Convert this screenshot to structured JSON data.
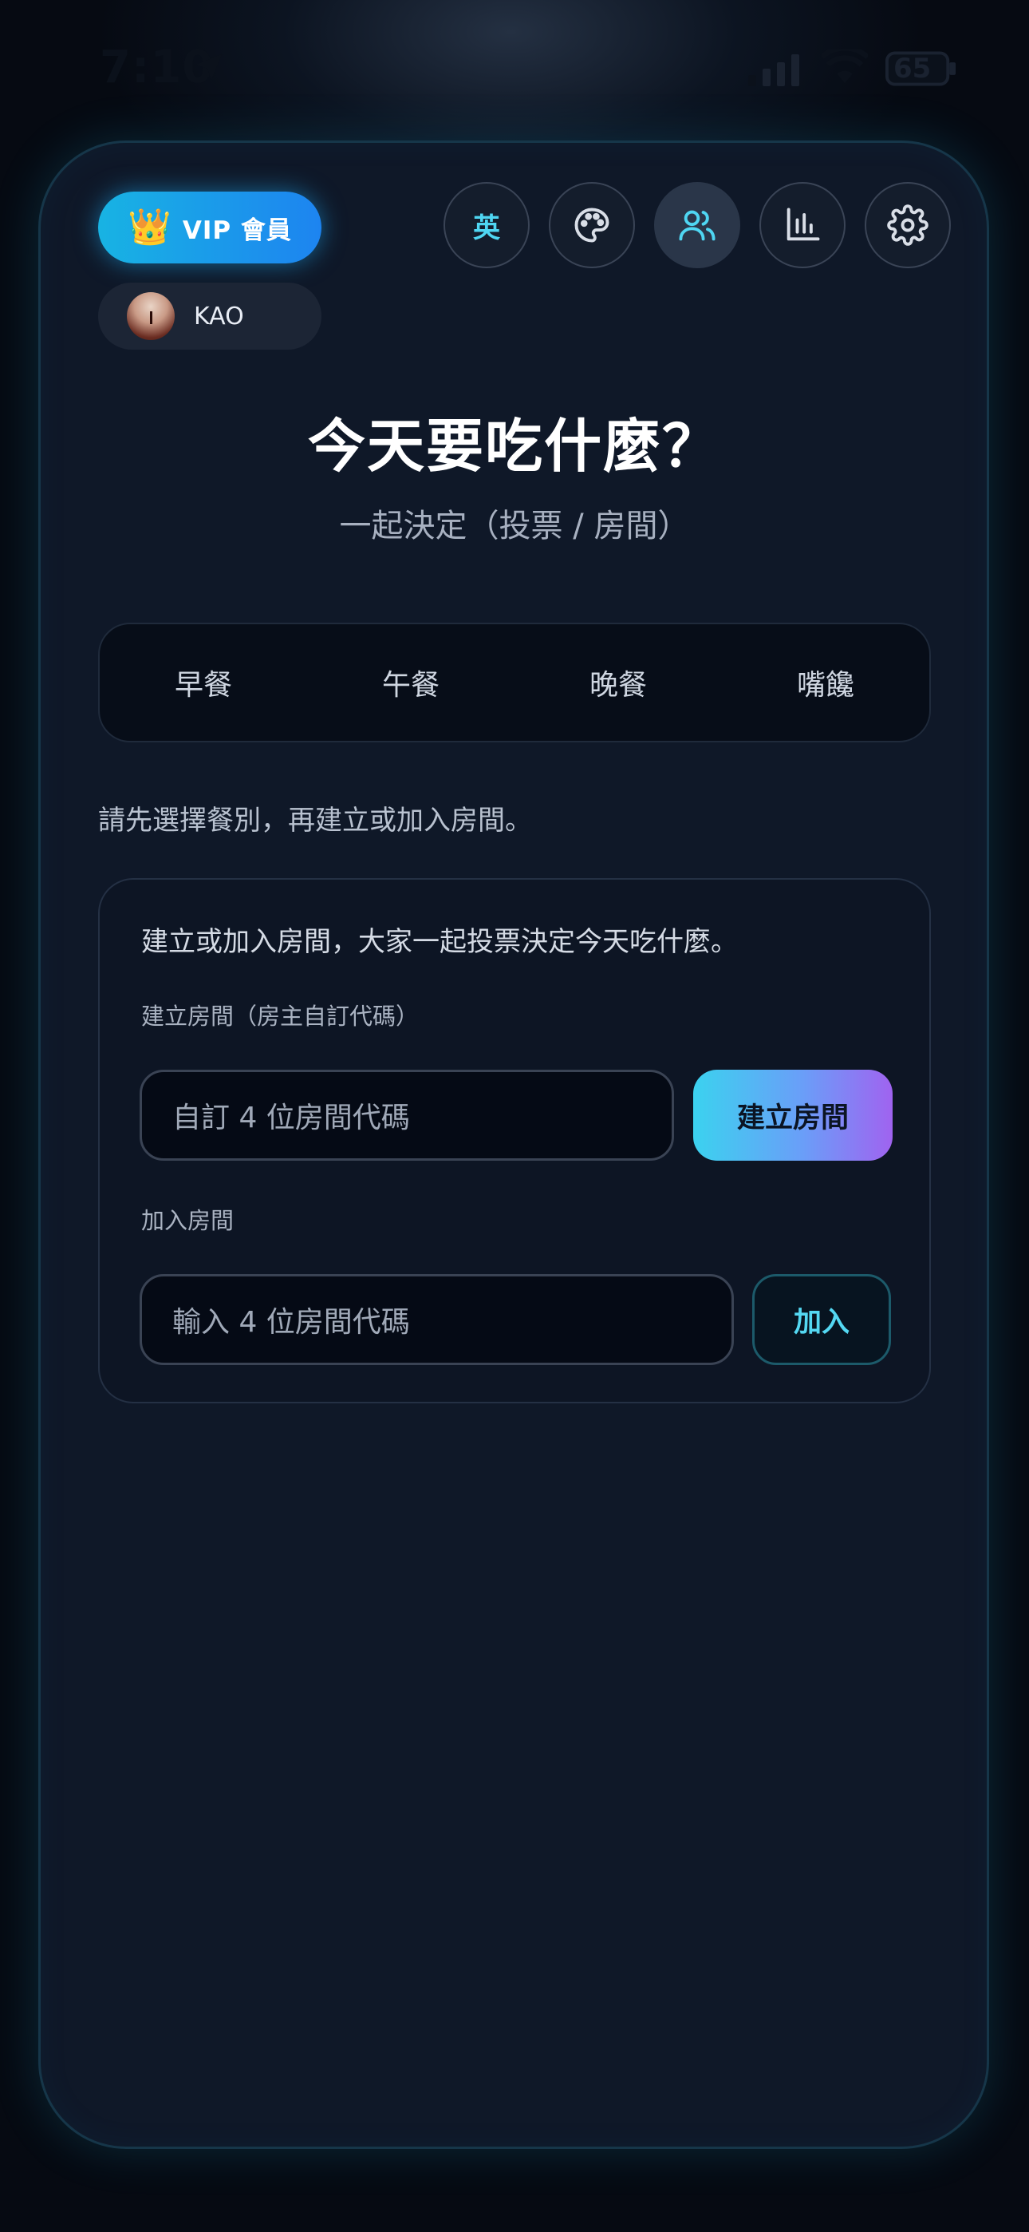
{
  "status_bar": {
    "time": "7:10",
    "battery": "65"
  },
  "header": {
    "vip_label": "VIP 會員",
    "user_name": "KAO",
    "lang_label": "英",
    "icons": [
      "palette-icon",
      "users-icon",
      "bar-chart-icon",
      "gear-icon"
    ]
  },
  "main": {
    "title": "今天要吃什麼？",
    "subtitle": "一起決定（投票 / 房間）",
    "meals": [
      "早餐",
      "午餐",
      "晚餐",
      "嘴饞"
    ],
    "hint": "請先選擇餐別，再建立或加入房間。"
  },
  "room": {
    "intro": "建立或加入房間，大家一起投票決定今天吃什麼。",
    "create_label": "建立房間（房主自訂代碼）",
    "create_placeholder": "自訂 4 位房間代碼",
    "create_button": "建立房間",
    "join_label": "加入房間",
    "join_placeholder": "輸入 4 位房間代碼",
    "join_button": "加入"
  },
  "colors": {
    "accent": "#4fd6f2",
    "vip_gradient_start": "#18b3e3",
    "create_gradient_end": "#a063f0"
  }
}
